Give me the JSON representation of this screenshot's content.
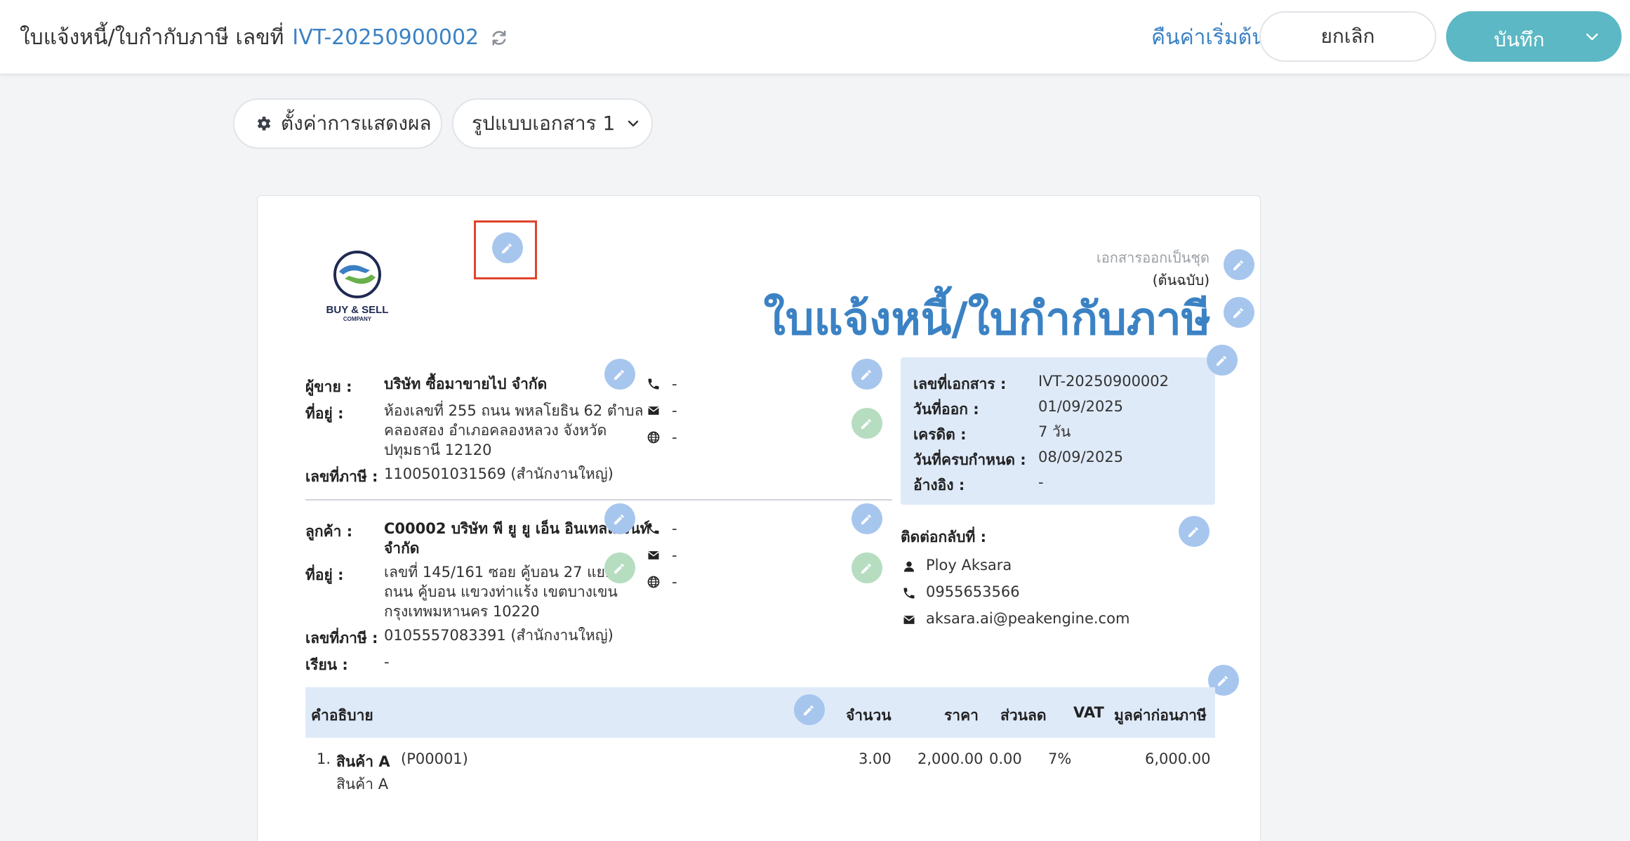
{
  "header": {
    "title": "ใบแจ้งหนี้/ใบกำกับภาษี เลขที่",
    "doc_number": "IVT-20250900002",
    "reset_label": "คืนค่าเริ่มต้น",
    "cancel_label": "ยกเลิก",
    "save_label": "บันทึก"
  },
  "toolbar": {
    "settings_label": "ตั้งค่าการแสดงผล",
    "format_label": "รูปแบบเอกสาร 1"
  },
  "logo": {
    "line1": "BUY & SELL",
    "line2": "COMPANY"
  },
  "document": {
    "copy_label": "เอกสารออกเป็นชุด",
    "copy_sub": "(ต้นฉบับ)",
    "title": "ใบแจ้งหนี้/ใบกำกับภาษี"
  },
  "seller": {
    "label": "ผู้ขาย :",
    "name": "บริษัท ซื้อมาขายไป จำกัด",
    "address_label": "ที่อยู่ :",
    "address_lines": [
      "ห้องเลขที่ 255 ถนน พหลโยธิน 62 ตำบล",
      "คลองสอง อำเภอคลองหลวง จังหวัด",
      "ปทุมธานี 12120"
    ],
    "tax_label": "เลขที่ภาษี :",
    "tax_id": "1100501031569 (สำนักงานใหญ่)",
    "phone": "-",
    "email": "-",
    "web": "-"
  },
  "customer": {
    "label": "ลูกค้า :",
    "name_lines": [
      "C00002 บริษัท พี ยู ยู เอ็น อินเทลลิเจนท์",
      "จำกัด"
    ],
    "address_label": "ที่อยู่ :",
    "address_lines": [
      "เลขที่ 145/161     ซอย คู้บอน 27 แยก 7",
      "ถนน คู้บอน  แขวงท่าแร้ง เขตบางเขน",
      "กรุงเทพมหานคร 10220"
    ],
    "tax_label": "เลขที่ภาษี :",
    "tax_id": "0105557083391 (สำนักงานใหญ่)",
    "attn_label": "เรียน :",
    "attn": "-",
    "phone": "-",
    "email": "-",
    "web": "-"
  },
  "info": {
    "doc_no_label": "เลขที่เอกสาร :",
    "doc_no": "IVT-20250900002",
    "issue_label": "วันที่ออก :",
    "issue_date": "01/09/2025",
    "credit_label": "เครดิต :",
    "credit": "7 วัน",
    "due_label": "วันที่ครบกำหนด :",
    "due_date": "08/09/2025",
    "ref_label": "อ้างอิง :",
    "ref": "-"
  },
  "contact": {
    "label": "ติดต่อกลับที่ :",
    "name": "Ploy Aksara",
    "phone": "0955653566",
    "email": "aksara.ai@peakengine.com"
  },
  "table": {
    "headers": {
      "description": "คำอธิบาย",
      "qty": "จำนวน",
      "price": "ราคา",
      "discount": "ส่วนลด",
      "vat": "VAT",
      "amount": "มูลค่าก่อนภาษี"
    },
    "rows": [
      {
        "no": "1.",
        "name": "สินค้า A",
        "code": "(P00001)",
        "detail": "สินค้า A",
        "qty": "3.00",
        "price": "2,000.00",
        "discount": "0.00",
        "vat": "7%",
        "amount": "6,000.00"
      }
    ]
  },
  "colors": {
    "accent": "#3b82c4",
    "save_button": "#5bb8c4",
    "edit_blue": "#a7c6ee",
    "edit_green": "#b6ddc0",
    "highlight": "#e0442c",
    "info_bg": "#dfeaf9"
  },
  "icons": [
    "refresh-icon",
    "chevron-down-icon",
    "gear-icon",
    "pencil-icon",
    "phone-icon",
    "envelope-icon",
    "globe-icon",
    "user-icon"
  ]
}
